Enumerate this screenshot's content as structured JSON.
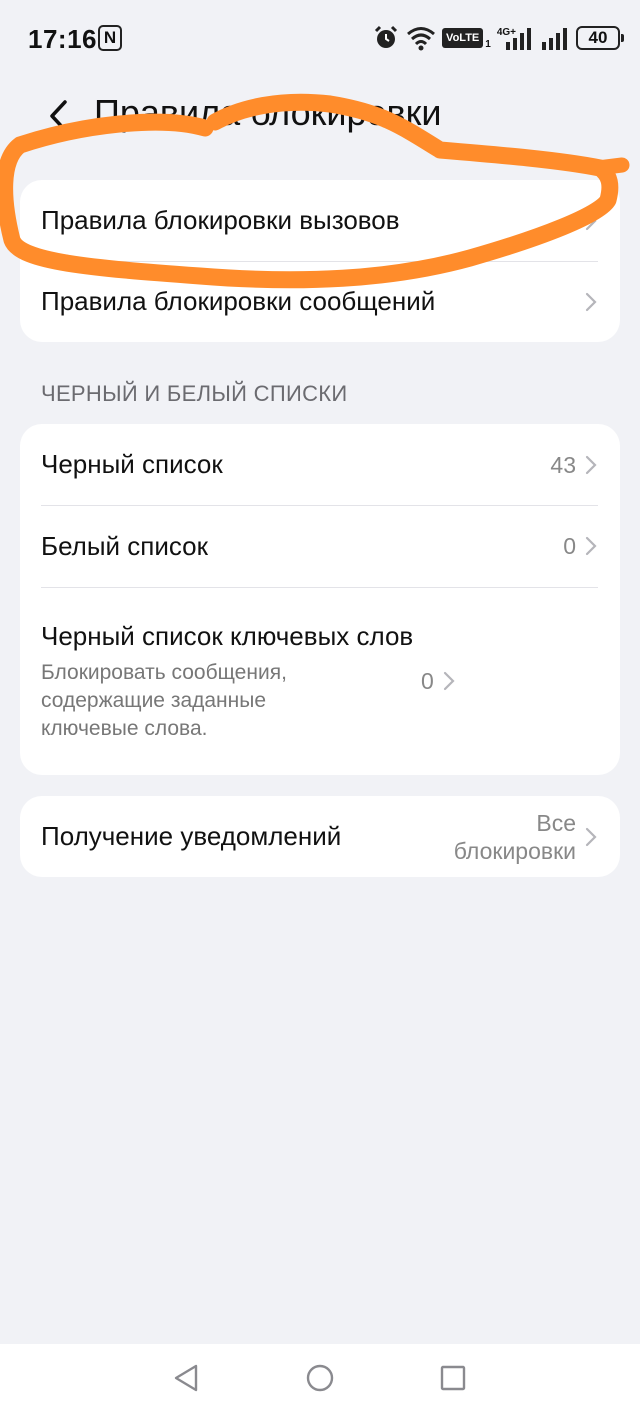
{
  "status_bar": {
    "time": "17:16",
    "nfc": "N",
    "volte": "VoLTE",
    "sim": "1",
    "network": "4G+",
    "battery": "40"
  },
  "header": {
    "title": "Правила блокировки"
  },
  "rules": [
    {
      "title": "Правила блокировки вызовов"
    },
    {
      "title": "Правила блокировки сообщений"
    }
  ],
  "lists_section": {
    "header": "ЧЕРНЫЙ И БЕЛЫЙ СПИСКИ",
    "items": [
      {
        "title": "Черный список",
        "value": "43"
      },
      {
        "title": "Белый список",
        "value": "0"
      },
      {
        "title": "Черный список ключевых слов",
        "subtitle": "Блокировать сообщения, содержащие заданные ключевые слова.",
        "value": "0"
      }
    ]
  },
  "notifications": {
    "title": "Получение уведомлений",
    "value": "Все блокировки"
  },
  "icons": {
    "back": "arrow-back-icon",
    "chevron": "chevron-right-icon",
    "nav_back": "triangle-back-icon",
    "nav_home": "circle-home-icon",
    "nav_recents": "square-recents-icon"
  },
  "colors": {
    "background": "#f1f2f6",
    "card": "#ffffff",
    "annotation": "#ff8c2b"
  }
}
